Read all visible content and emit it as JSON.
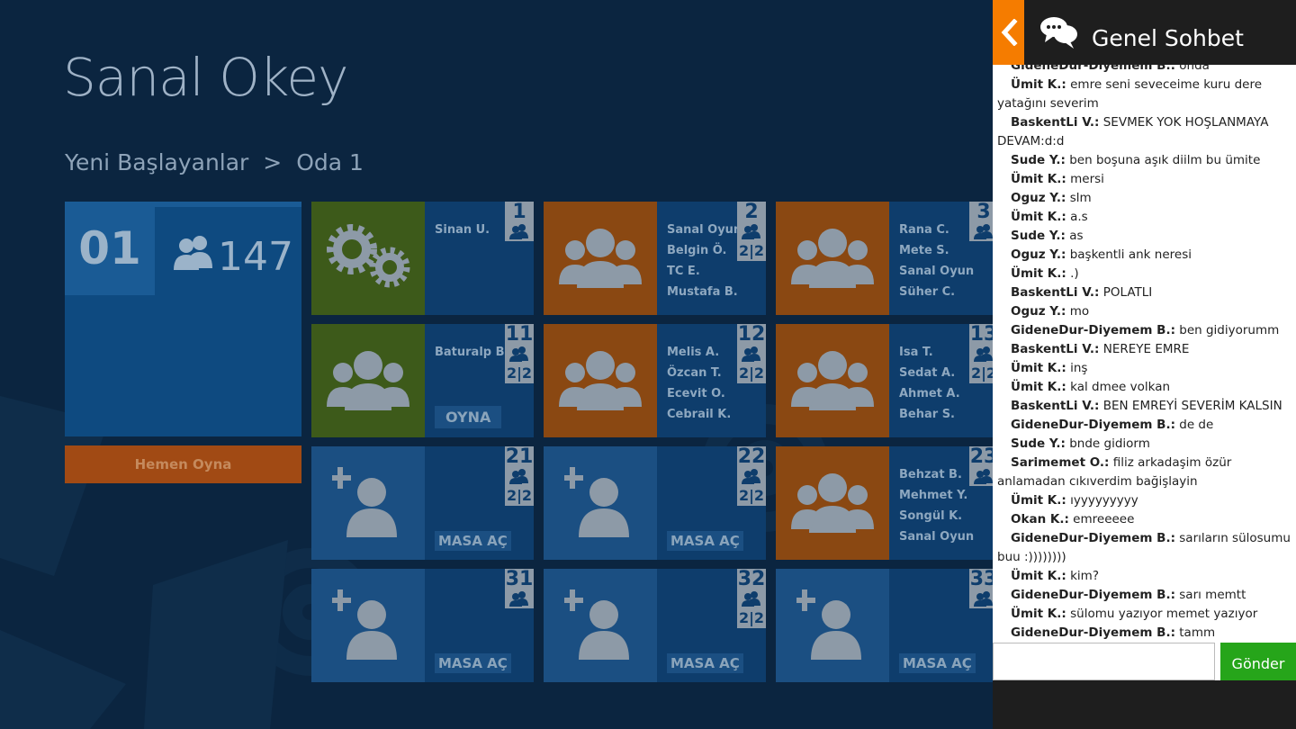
{
  "app": {
    "title": "Sanal Okey"
  },
  "breadcrumb": {
    "parts": [
      "Yeni Başlayanlar",
      ">",
      "Oda 1"
    ]
  },
  "summary": {
    "room_number": "01",
    "players": "147"
  },
  "quick_play_label": "Hemen Oyna",
  "tables": [
    {
      "num": "1",
      "ratio": "",
      "names": [
        "Sinan U."
      ],
      "icon": "settings-gears-icon",
      "color": "green",
      "button": ""
    },
    {
      "num": "2",
      "ratio": "2|2",
      "names": [
        "Sanal Oyun",
        "Belgin Ö.",
        "TC E.",
        "Mustafa B."
      ],
      "icon": "group-icon",
      "color": "orange",
      "button": ""
    },
    {
      "num": "3",
      "ratio": "",
      "names": [
        "Rana C.",
        "Mete S.",
        "Sanal Oyun",
        "Süher C."
      ],
      "icon": "group-icon",
      "color": "orange",
      "button": ""
    },
    {
      "num": "11",
      "ratio": "2|2",
      "names": [
        "Baturalp B."
      ],
      "icon": "group-icon",
      "color": "green",
      "button": "OYNA"
    },
    {
      "num": "12",
      "ratio": "2|2",
      "names": [
        "Melis A.",
        "Özcan T.",
        "Ecevit O.",
        "Cebrail K."
      ],
      "icon": "group-icon",
      "color": "orange",
      "button": ""
    },
    {
      "num": "13",
      "ratio": "2|2",
      "names": [
        "Isa T.",
        "Sedat A.",
        "Ahmet A.",
        "Behar S."
      ],
      "icon": "group-icon",
      "color": "orange",
      "button": ""
    },
    {
      "num": "21",
      "ratio": "2|2",
      "names": [],
      "icon": "add-user-icon",
      "color": "blue",
      "button": "MASA AÇ"
    },
    {
      "num": "22",
      "ratio": "2|2",
      "names": [],
      "icon": "add-user-icon",
      "color": "blue",
      "button": "MASA AÇ"
    },
    {
      "num": "23",
      "ratio": "",
      "names": [
        "Behzat B.",
        "Mehmet Y.",
        "Songül K.",
        "Sanal Oyun"
      ],
      "icon": "group-icon",
      "color": "orange",
      "button": ""
    },
    {
      "num": "31",
      "ratio": "",
      "names": [],
      "icon": "add-user-icon",
      "color": "blue",
      "button": "MASA AÇ"
    },
    {
      "num": "32",
      "ratio": "2|2",
      "names": [],
      "icon": "add-user-icon",
      "color": "blue",
      "button": "MASA AÇ"
    },
    {
      "num": "33",
      "ratio": "",
      "names": [],
      "icon": "add-user-icon",
      "color": "blue",
      "button": "MASA AÇ"
    }
  ],
  "chat": {
    "title": "Genel Sohbet",
    "messages": [
      {
        "who": "GideneDur-Diyemem B.:",
        "text": "onda"
      },
      {
        "who": "Ümit K.:",
        "text": "emre seni seveceime kuru dere yatağını severim"
      },
      {
        "who": "BaskentLi V.:",
        "text": "SEVMEK YOK HOŞLANMAYA DEVAM:d:d"
      },
      {
        "who": "Sude Y.:",
        "text": "ben boşuna aşık diilm bu ümite"
      },
      {
        "who": "Ümit K.:",
        "text": "mersi"
      },
      {
        "who": "Oguz Y.:",
        "text": "slm"
      },
      {
        "who": "Ümit K.:",
        "text": "a.s"
      },
      {
        "who": "Sude Y.:",
        "text": "as"
      },
      {
        "who": "Oguz Y.:",
        "text": "başkentli ank neresi"
      },
      {
        "who": "Ümit K.:",
        "text": ".)"
      },
      {
        "who": "BaskentLi V.:",
        "text": "POLATLI"
      },
      {
        "who": "Oguz Y.:",
        "text": "mo"
      },
      {
        "who": "GideneDur-Diyemem B.:",
        "text": "ben gidiyorumm"
      },
      {
        "who": "BaskentLi V.:",
        "text": "NEREYE EMRE"
      },
      {
        "who": "Ümit K.:",
        "text": "inş"
      },
      {
        "who": "Ümit K.:",
        "text": "kal dmee volkan"
      },
      {
        "who": "BaskentLi V.:",
        "text": "BEN EMREYİ SEVERİM KALSIN"
      },
      {
        "who": "GideneDur-Diyemem B.:",
        "text": "de de"
      },
      {
        "who": "Sude Y.:",
        "text": "bnde gidiorm"
      },
      {
        "who": "Sarimemet O.:",
        "text": "filiz arkadaşim özür anlamadan cıkıverdim bağişlayin"
      },
      {
        "who": "Ümit K.:",
        "text": "ıyyyyyyyyy"
      },
      {
        "who": "Okan K.:",
        "text": "emreeeee"
      },
      {
        "who": "GideneDur-Diyemem B.:",
        "text": "sarıların sülosumu buu :))))))))"
      },
      {
        "who": "Ümit K.:",
        "text": "kim?"
      },
      {
        "who": "GideneDur-Diyemem B.:",
        "text": "sarı memtt"
      },
      {
        "who": "Ümit K.:",
        "text": "sülomu yazıyor memet yazıyor"
      },
      {
        "who": "GideneDur-Diyemem B.:",
        "text": "tamm"
      }
    ],
    "input_value": "",
    "send_label": "Gönder"
  }
}
